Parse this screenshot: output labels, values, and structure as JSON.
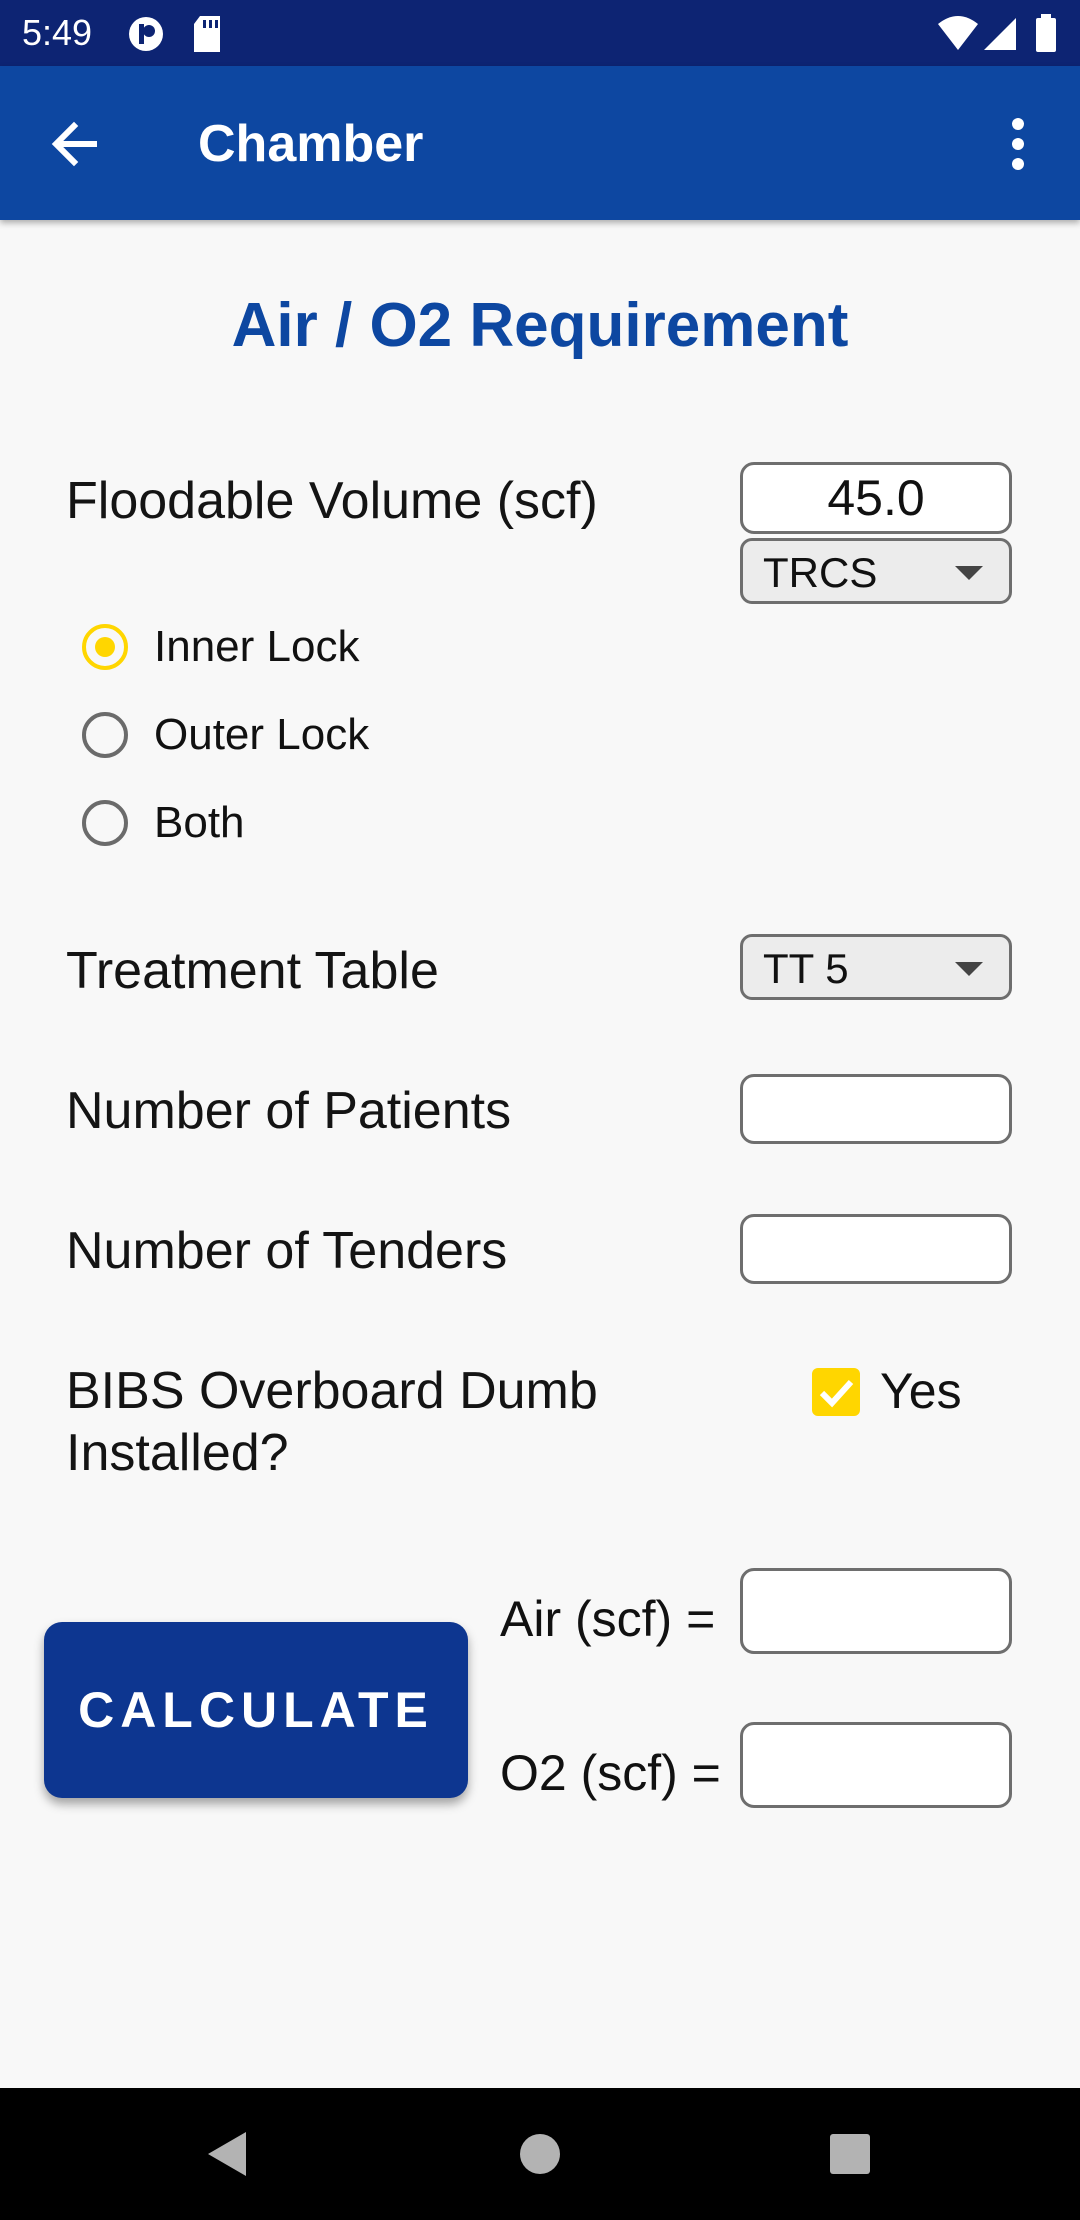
{
  "status_bar": {
    "time": "5:49",
    "icons": [
      "app-icon",
      "sd-card-icon",
      "wifi-icon",
      "signal-icon",
      "battery-icon"
    ]
  },
  "app_bar": {
    "title": "Chamber",
    "back_icon": "arrow-back-icon",
    "menu_icon": "more-vert-icon",
    "color": "#0d47a1"
  },
  "heading": "Air / O2 Requirement",
  "floodable": {
    "label": "Floodable Volume (scf)",
    "value": "45.0",
    "chamber_select": "TRCS"
  },
  "lock_options": [
    {
      "label": "Inner Lock",
      "selected": true
    },
    {
      "label": "Outer Lock",
      "selected": false
    },
    {
      "label": "Both",
      "selected": false
    }
  ],
  "treatment_table": {
    "label": "Treatment Table",
    "value": "TT 5"
  },
  "patients": {
    "label": "Number of Patients",
    "value": ""
  },
  "tenders": {
    "label": "Number of Tenders",
    "value": ""
  },
  "bibs": {
    "label_line1": "BIBS Overboard Dumb",
    "label_line2": "Installed?",
    "checkbox_label": "Yes",
    "checked": true
  },
  "calculate_label": "CALCULATE",
  "results": {
    "air_label": "Air (scf) =",
    "air_value": "",
    "o2_label": "O2 (scf) =",
    "o2_value": ""
  },
  "colors": {
    "accent": "#ffd600",
    "primary": "#0d47a1",
    "status_bar": "#0d2473",
    "button": "#0d3690"
  },
  "nav_bar": {
    "icons": [
      "back-triangle-icon",
      "home-circle-icon",
      "recents-square-icon"
    ]
  }
}
